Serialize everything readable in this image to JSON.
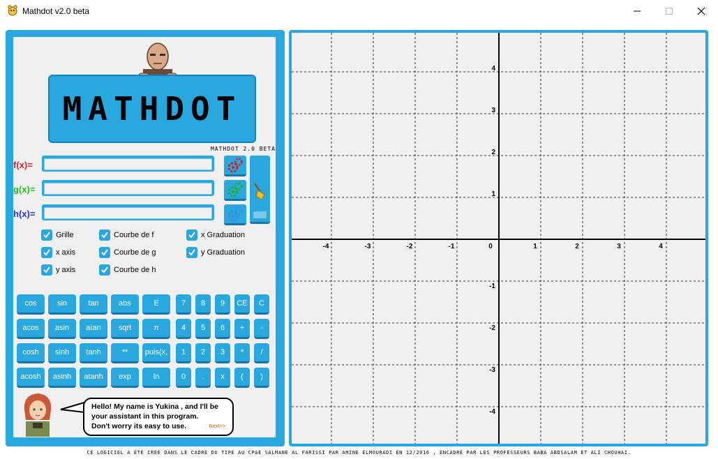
{
  "window": {
    "title": "Mathdot v2.0 beta"
  },
  "logo": {
    "text": "MATHDOT",
    "subtitle": "MATHDOT 2.0 BETA"
  },
  "functions": [
    {
      "label": "f(x)=",
      "value": "",
      "color": "#e02020"
    },
    {
      "label": "g(x)=",
      "value": "",
      "color": "#20c020"
    },
    {
      "label": "h(x)=",
      "value": "",
      "color": "#2030d0"
    }
  ],
  "checkboxes": {
    "col1": [
      {
        "label": "Grille",
        "checked": true
      },
      {
        "label": "x axis",
        "checked": true
      },
      {
        "label": "y axis",
        "checked": true
      }
    ],
    "col2": [
      {
        "label": "Courbe de f",
        "checked": true
      },
      {
        "label": "Courbe de g",
        "checked": true
      },
      {
        "label": "Courbe de h",
        "checked": true
      }
    ],
    "col3": [
      {
        "label": "x Graduation",
        "checked": true
      },
      {
        "label": "y Graduation",
        "checked": true
      }
    ]
  },
  "keypad": {
    "fn_rows": [
      [
        "cos",
        "sin",
        "tan",
        "abs",
        "E"
      ],
      [
        "acos",
        "asin",
        "atan",
        "sqrt",
        "π"
      ],
      [
        "cosh",
        "sinh",
        "tanh",
        "**",
        "puis(x,"
      ],
      [
        "acosh",
        "asinh",
        "atanh",
        "exp",
        "ln"
      ]
    ],
    "num_rows": [
      [
        "7",
        "8",
        "9",
        "CE",
        "C"
      ],
      [
        "4",
        "5",
        "6",
        "+",
        "-"
      ],
      [
        "1",
        "2",
        "3",
        "*",
        "/"
      ],
      [
        "0",
        ".",
        "x",
        "(",
        ")"
      ]
    ]
  },
  "assistant": {
    "line1": "Hello! My name is Yukina , and I'll be",
    "line2": "your assistant in this program.",
    "line3": "Don't worry its easy to use.",
    "next": "Next>>"
  },
  "graph": {
    "x_ticks": [
      "-4",
      "-3",
      "-2",
      "-1",
      "0",
      "1",
      "2",
      "3",
      "4"
    ],
    "y_ticks_pos": [
      "4",
      "3",
      "2",
      "1"
    ],
    "y_ticks_neg": [
      "-1",
      "-2",
      "-3",
      "-4"
    ],
    "grid": true
  },
  "footer": {
    "text": "CE LOGICIEL A ÉTÉ CRÉÉ DANS LE CADRE DU TIPE AU CPGE SALMANE AL FARISSI PAR AMINE ELMOURADI EN 12/2016 , ENCADRÉ PAR LES PROFESSEURS BABA ABDSALAM ET ALI CHOUHAI."
  },
  "colors": {
    "accent": "#29a8e0",
    "panel_bg": "#f0f0f0"
  }
}
